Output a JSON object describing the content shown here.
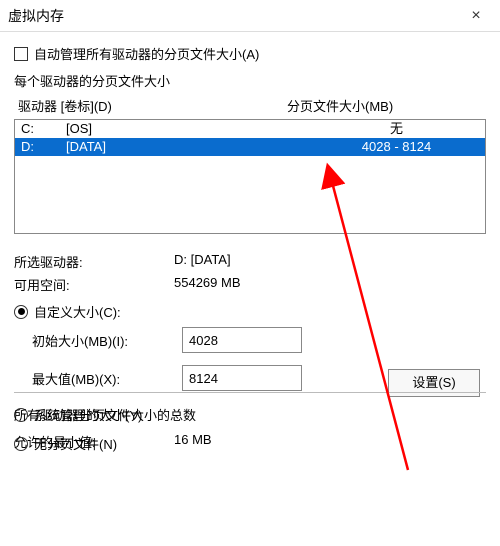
{
  "title": "虚拟内存",
  "auto_manage": "自动管理所有驱动器的分页文件大小(A)",
  "per_drive_label": "每个驱动器的分页文件大小",
  "header_drive": "驱动器 [卷标](D)",
  "header_page": "分页文件大小(MB)",
  "rows": [
    {
      "drive": "C:",
      "label": "[OS]",
      "size": "无"
    },
    {
      "drive": "D:",
      "label": "[DATA]",
      "size": "4028 - 8124"
    }
  ],
  "selected_label": "所选驱动器:",
  "selected_value": "D:  [DATA]",
  "free_label": "可用空间:",
  "free_value": "554269 MB",
  "custom_size": "自定义大小(C):",
  "init_label": "初始大小(MB)(I):",
  "init_value": "4028",
  "max_label": "最大值(MB)(X):",
  "max_value": "8124",
  "sys_managed": "系统管理的大小(Y)",
  "no_paging": "无分页文件(N)",
  "set_btn": "设置(S)",
  "total_label": "所有驱动器分页文件大小的总数",
  "min_allowed_label": "允许的最小值:",
  "min_allowed_value": "16 MB"
}
